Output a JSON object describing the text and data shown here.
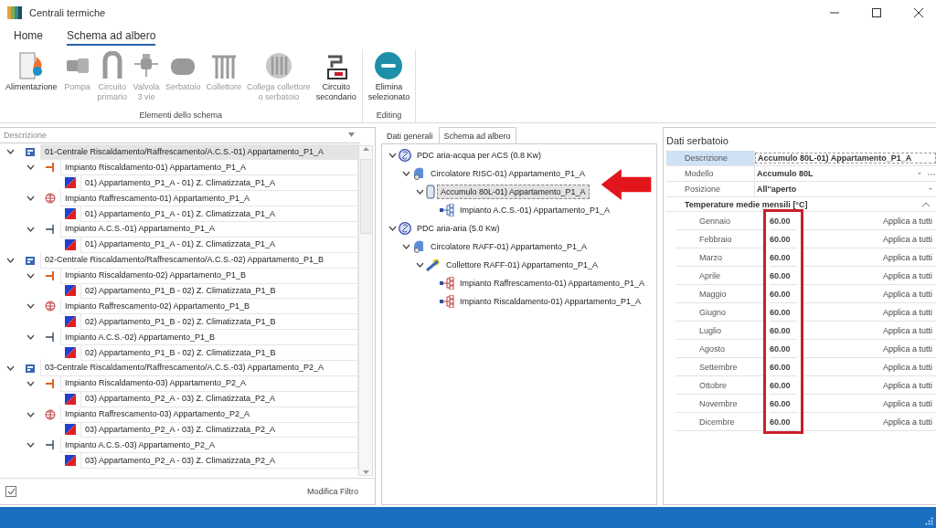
{
  "window": {
    "title": "Centrali termiche"
  },
  "ribbon_tabs": [
    {
      "label": "Home",
      "selected": false
    },
    {
      "label": "Schema ad albero",
      "selected": true
    }
  ],
  "ribbon_groups": [
    {
      "label": "Elementi dello schema",
      "buttons": [
        {
          "kind": "feed",
          "lines": [
            "Alimentazione"
          ],
          "disabled": false
        },
        {
          "kind": "pump",
          "lines": [
            "Pompa"
          ],
          "disabled": true
        },
        {
          "kind": "primary",
          "lines": [
            "Circuito",
            "primario"
          ],
          "disabled": true
        },
        {
          "kind": "valve",
          "lines": [
            "Valvola",
            "3 vie"
          ],
          "disabled": true
        },
        {
          "kind": "tank",
          "lines": [
            "Serbatoio"
          ],
          "disabled": true
        },
        {
          "kind": "manifold",
          "lines": [
            "Collettore"
          ],
          "disabled": true
        },
        {
          "kind": "connect",
          "lines": [
            "Collega collettore",
            "o serbatoio"
          ],
          "disabled": true
        },
        {
          "kind": "secondary",
          "lines": [
            "Circuito",
            "secondario"
          ],
          "disabled": false
        }
      ]
    },
    {
      "label": "Editing",
      "buttons": [
        {
          "kind": "delete",
          "lines": [
            "Elimina",
            "selezionato"
          ],
          "disabled": false
        }
      ]
    }
  ],
  "left_panel": {
    "column_header": "Descrizione",
    "tree": [
      {
        "kind": "plant",
        "label": "01-Centrale Riscaldamento/Raffrescamento/A.C.S.-01) Appartamento_P1_A",
        "selected": true,
        "expanded": true,
        "children": [
          {
            "kind": "heating",
            "label": "Impianto Riscaldamento-01) Appartamento_P1_A",
            "selected": false,
            "expanded": true,
            "children": [
              {
                "kind": "zone",
                "label": "01) Appartamento_P1_A - 01) Z. Climatizzata_P1_A",
                "selected": false
              }
            ]
          },
          {
            "kind": "cooling",
            "label": "Impianto Raffrescamento-01) Appartamento_P1_A",
            "selected": false,
            "expanded": true,
            "children": [
              {
                "kind": "zone",
                "label": "01) Appartamento_P1_A - 01) Z. Climatizzata_P1_A",
                "selected": false
              }
            ]
          },
          {
            "kind": "dhw",
            "label": "Impianto A.C.S.-01) Appartamento_P1_A",
            "selected": false,
            "expanded": true,
            "children": [
              {
                "kind": "zone",
                "label": "01) Appartamento_P1_A - 01) Z. Climatizzata_P1_A",
                "selected": false
              }
            ]
          }
        ]
      },
      {
        "kind": "plant",
        "label": "02-Centrale Riscaldamento/Raffrescamento/A.C.S.-02) Appartamento_P1_B",
        "selected": false,
        "expanded": true,
        "children": [
          {
            "kind": "heating",
            "label": "Impianto Riscaldamento-02) Appartamento_P1_B",
            "selected": false,
            "expanded": true,
            "children": [
              {
                "kind": "zone",
                "label": "02) Appartamento_P1_B - 02) Z. Climatizzata_P1_B",
                "selected": false
              }
            ]
          },
          {
            "kind": "cooling",
            "label": "Impianto Raffrescamento-02) Appartamento_P1_B",
            "selected": false,
            "expanded": true,
            "children": [
              {
                "kind": "zone",
                "label": "02) Appartamento_P1_B - 02) Z. Climatizzata_P1_B",
                "selected": false
              }
            ]
          },
          {
            "kind": "dhw",
            "label": "Impianto A.C.S.-02) Appartamento_P1_B",
            "selected": false,
            "expanded": true,
            "children": [
              {
                "kind": "zone",
                "label": "02) Appartamento_P1_B - 02) Z. Climatizzata_P1_B",
                "selected": false
              }
            ]
          }
        ]
      },
      {
        "kind": "plant",
        "label": "03-Centrale Riscaldamento/Raffrescamento/A.C.S.-03) Appartamento_P2_A",
        "selected": false,
        "expanded": true,
        "children": [
          {
            "kind": "heating",
            "label": "Impianto Riscaldamento-03) Appartamento_P2_A",
            "selected": false,
            "expanded": true,
            "children": [
              {
                "kind": "zone",
                "label": "03) Appartamento_P2_A - 03) Z. Climatizzata_P2_A",
                "selected": false
              }
            ]
          },
          {
            "kind": "cooling",
            "label": "Impianto Raffrescamento-03) Appartamento_P2_A",
            "selected": false,
            "expanded": true,
            "children": [
              {
                "kind": "zone",
                "label": "03) Appartamento_P2_A - 03) Z. Climatizzata_P2_A",
                "selected": false
              }
            ]
          },
          {
            "kind": "dhw",
            "label": "Impianto A.C.S.-03) Appartamento_P2_A",
            "selected": false,
            "expanded": true,
            "children": [
              {
                "kind": "zone",
                "label": "03) Appartamento_P2_A - 03) Z. Climatizzata_P2_A",
                "selected": false
              }
            ]
          }
        ]
      }
    ],
    "filter_checked": true,
    "filter_button": "Modifica Filtro"
  },
  "middle_tabs": [
    {
      "label": "Dati generali",
      "selected": false
    },
    {
      "label": "Schema ad albero",
      "selected": true
    }
  ],
  "schema_tree": [
    {
      "kind": "heatpump",
      "label": "PDC aria-acqua per ACS (0.8 Kw)",
      "selected": false,
      "expanded": true,
      "children": [
        {
          "kind": "circulator",
          "label": "Circolatore RISC-01) Appartamento_P1_A",
          "selected": false,
          "expanded": true,
          "children": [
            {
              "kind": "tank",
              "label": "Accumulo 80L-01) Appartamento_P1_A",
              "selected": true,
              "expanded": true,
              "children": [
                {
                  "kind": "system-dhw",
                  "label": "Impianto A.C.S.-01) Appartamento_P1_A",
                  "selected": false
                }
              ]
            }
          ]
        }
      ]
    },
    {
      "kind": "heatpump",
      "label": "PDC aria-aria (5.0 Kw)",
      "selected": false,
      "expanded": true,
      "children": [
        {
          "kind": "circulator",
          "label": "Circolatore RAFF-01) Appartamento_P1_A",
          "selected": false,
          "expanded": true,
          "children": [
            {
              "kind": "collector",
              "label": "Collettore RAFF-01) Appartamento_P1_A",
              "selected": false,
              "expanded": true,
              "children": [
                {
                  "kind": "system-cool",
                  "label": "Impianto Raffrescamento-01) Appartamento_P1_A",
                  "selected": false
                },
                {
                  "kind": "system-heat",
                  "label": "Impianto Riscaldamento-01) Appartamento_P1_A",
                  "selected": false
                }
              ]
            }
          ]
        }
      ]
    }
  ],
  "properties": {
    "title": "Dati serbatoio",
    "rows": [
      {
        "kind": "text",
        "label": "Descrizione",
        "value": "Accumulo 80L-01) Appartamento_P1_A",
        "selected": true
      },
      {
        "kind": "dropdown-more",
        "label": "Modello",
        "value": "Accumulo 80L",
        "selected": false
      },
      {
        "kind": "dropdown",
        "label": "Posizione",
        "value": "All''aperto",
        "selected": false
      }
    ],
    "group": {
      "label": "Temperature medie mensili [°C]",
      "expanded": true,
      "rows": [
        {
          "label": "Gennaio",
          "value": "60.00",
          "action": "Applica a tutti"
        },
        {
          "label": "Febbraio",
          "value": "60.00",
          "action": "Applica a tutti"
        },
        {
          "label": "Marzo",
          "value": "60.00",
          "action": "Applica a tutti"
        },
        {
          "label": "Aprile",
          "value": "60.00",
          "action": "Applica a tutti"
        },
        {
          "label": "Maggio",
          "value": "60.00",
          "action": "Applica a tutti"
        },
        {
          "label": "Giugno",
          "value": "60.00",
          "action": "Applica a tutti"
        },
        {
          "label": "Luglio",
          "value": "60.00",
          "action": "Applica a tutti"
        },
        {
          "label": "Agosto",
          "value": "60.00",
          "action": "Applica a tutti"
        },
        {
          "label": "Settembre",
          "value": "60.00",
          "action": "Applica a tutti"
        },
        {
          "label": "Ottobre",
          "value": "60.00",
          "action": "Applica a tutti"
        },
        {
          "label": "Novembre",
          "value": "60.00",
          "action": "Applica a tutti"
        },
        {
          "label": "Dicembre",
          "value": "60.00",
          "action": "Applica a tutti"
        }
      ]
    }
  }
}
